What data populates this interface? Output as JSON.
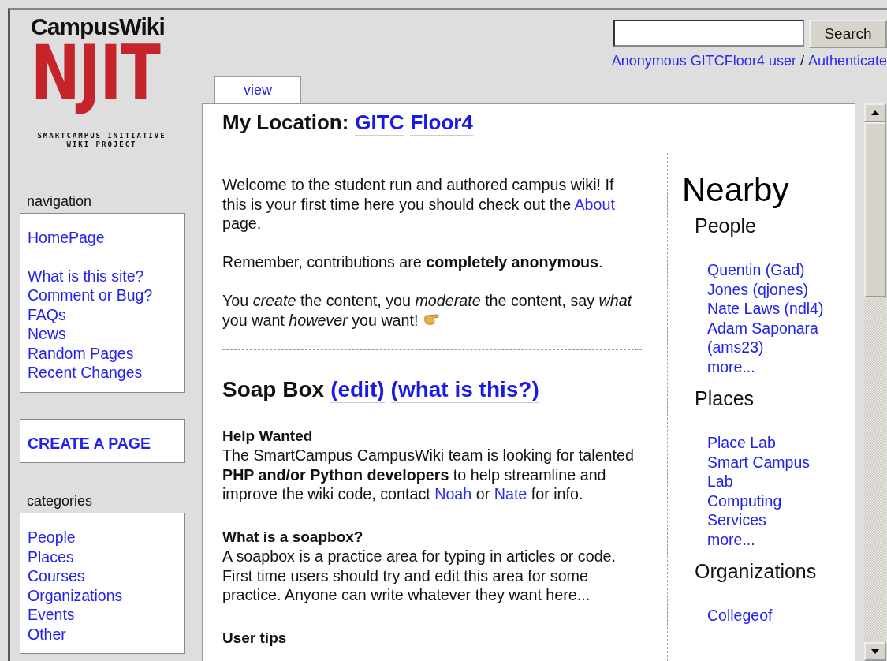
{
  "logo": {
    "title": "CampusWiki",
    "mark": "NJIT",
    "tagline": "SMARTCAMPUS INITIATIVE WIKI PROJECT"
  },
  "sidebar": {
    "sections": [
      {
        "heading": "navigation",
        "groups": [
          [
            "HomePage"
          ],
          [
            "What is this site?",
            "Comment or Bug?",
            "FAQs",
            "News",
            "Random Pages",
            "Recent Changes"
          ]
        ]
      },
      {
        "kind": "action",
        "groups": [
          [
            "CREATE A PAGE"
          ]
        ]
      },
      {
        "heading": "categories",
        "groups": [
          [
            "People",
            "Places",
            "Courses",
            "Organizations",
            "Events",
            "Other"
          ]
        ]
      }
    ]
  },
  "search": {
    "button": "Search"
  },
  "user_line": {
    "user": "Anonymous GITCFloor4 user",
    "separator": "/",
    "action": "Authenticate"
  },
  "tabs": [
    {
      "label": "view",
      "selected": true
    }
  ],
  "title": {
    "label": "My Location:",
    "links": [
      "GITC",
      "Floor4"
    ]
  },
  "intro": [
    [
      {
        "kind": "text",
        "text": "Welcome to the student run and authored campus wiki! If this is your first time here you should check out the "
      },
      {
        "kind": "link",
        "text": "About"
      },
      {
        "kind": "text",
        "text": " page."
      }
    ],
    [
      {
        "kind": "text",
        "text": "Remember, contributions are **completely anonymous**."
      }
    ],
    [
      {
        "kind": "text",
        "text": "You *create* the content, you *moderate* the content, say *what* you want *however* you want! "
      },
      {
        "kind": "icon"
      }
    ]
  ],
  "soapbox": {
    "heading": "Soap Box",
    "links": [
      "(edit)",
      "(what is this?)"
    ],
    "sections": [
      {
        "heading": "Help Wanted",
        "body": [
          {
            "kind": "text",
            "text": "The SmartCampus CampusWiki team is looking for talented **PHP and/or Python developers** to help streamline and improve the wiki code, contact "
          },
          {
            "kind": "link",
            "text": "Noah"
          },
          {
            "kind": "text",
            "text": " or "
          },
          {
            "kind": "link",
            "text": "Nate"
          },
          {
            "kind": "text",
            "text": " for info."
          }
        ]
      },
      {
        "heading": "What is a soapbox?",
        "body": [
          {
            "kind": "text",
            "text": "A soapbox is a practice area for typing in articles or code. First time users should try and edit this area for some practice. Anyone can write whatever they want here..."
          }
        ]
      },
      {
        "heading": "User tips"
      }
    ]
  },
  "nearby": {
    "title": "Nearby",
    "groups": [
      {
        "heading": "People",
        "items": [
          "Quentin (Gad)",
          "Jones (qjones)",
          "Nate Laws (ndl4)",
          "Adam Saponara (ams23)",
          "more..."
        ]
      },
      {
        "heading": "Places",
        "items": [
          "Place Lab",
          "Smart Campus Lab",
          "Computing Services",
          "more..."
        ]
      },
      {
        "heading": "Organizations",
        "items": [
          "Collegeof"
        ]
      }
    ]
  }
}
